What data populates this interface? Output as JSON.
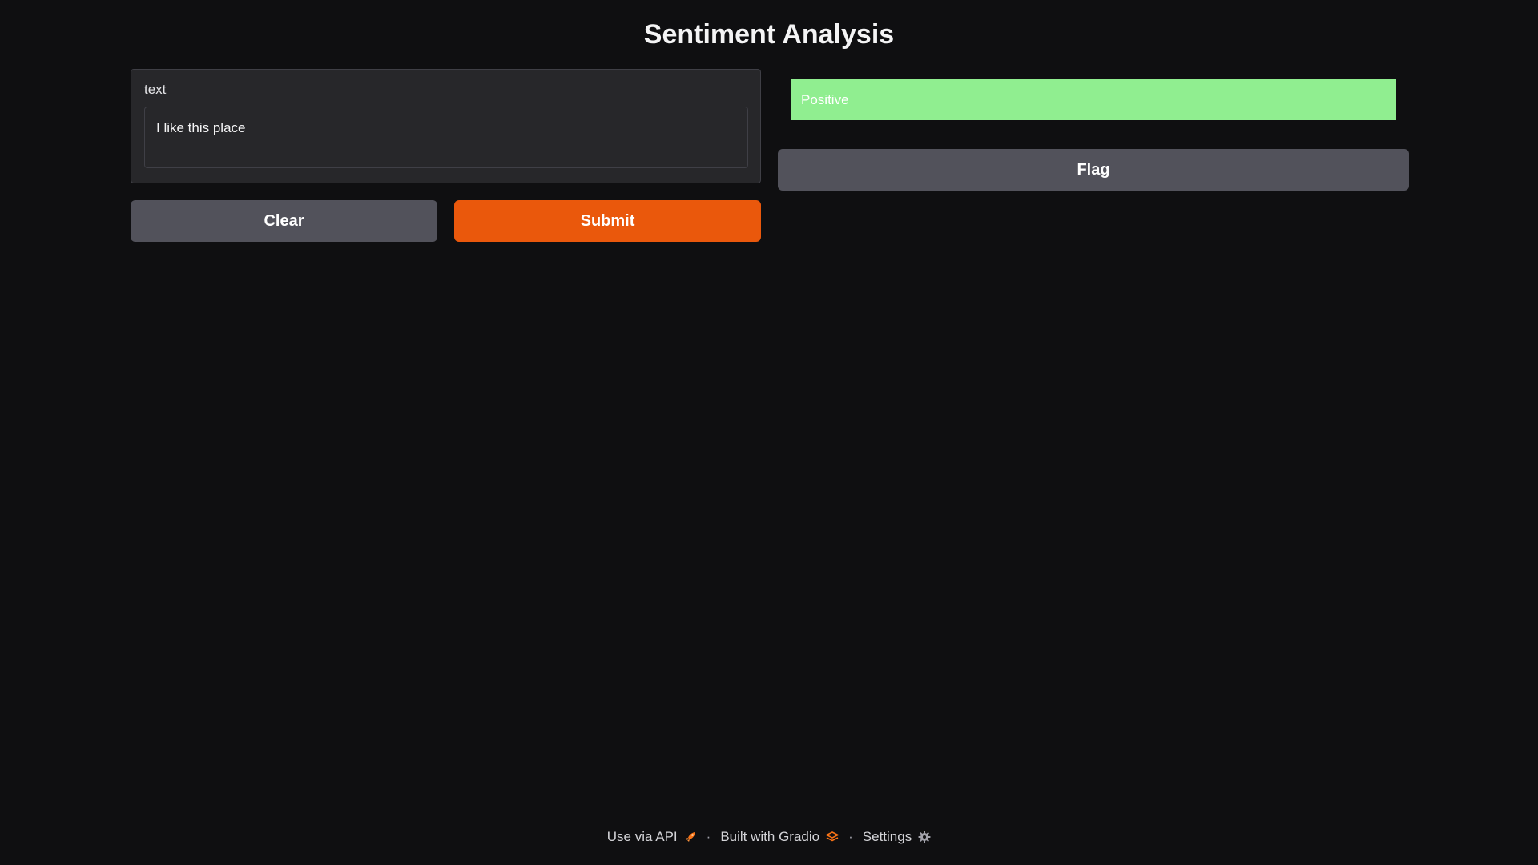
{
  "app": {
    "title": "Sentiment Analysis"
  },
  "input": {
    "label": "text",
    "value": "I like this place"
  },
  "buttons": {
    "clear_label": "Clear",
    "submit_label": "Submit",
    "flag_label": "Flag"
  },
  "output": {
    "label": "Positive",
    "color": "#90ee90"
  },
  "footer": {
    "api_label": "Use via API",
    "built_label": "Built with Gradio",
    "settings_label": "Settings",
    "separator": "·",
    "api_icon": "rocket-icon",
    "gradio_icon": "gradio-logo-icon",
    "settings_icon": "gear-icon"
  },
  "colors": {
    "background": "#0f0f11",
    "accent": "#ea580c",
    "secondary_button": "#52525b"
  }
}
